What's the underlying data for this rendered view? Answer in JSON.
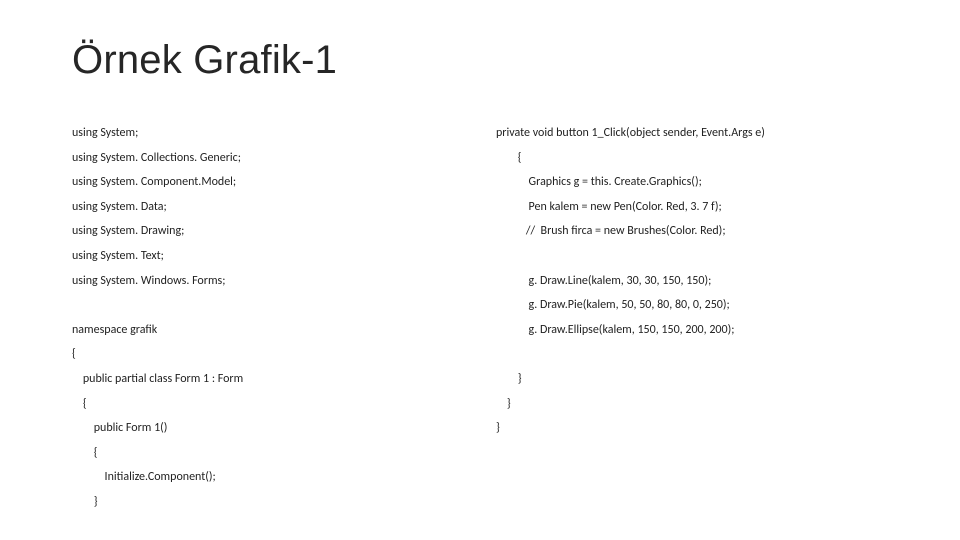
{
  "title": "Örnek Grafik-1",
  "left": [
    "using System;",
    "using System. Collections. Generic;",
    "using System. Component.Model;",
    "using System. Data;",
    "using System. Drawing;",
    "using System. Text;",
    "using System. Windows. Forms;",
    "",
    "namespace grafik",
    "{",
    "    public partial class Form 1 : Form",
    "    {",
    "        public Form 1()",
    "        {",
    "            Initialize.Component();",
    "        }"
  ],
  "right": [
    "private void button 1_Click(object sender, Event.Args e)",
    "        {",
    "            Graphics g = this. Create.Graphics();",
    "            Pen kalem = new Pen(Color. Red, 3. 7 f);",
    "           //  Brush firca = new Brushes(Color. Red);",
    "",
    "            g. Draw.Line(kalem, 30, 30, 150, 150);",
    "            g. Draw.Pie(kalem, 50, 50, 80, 80, 0, 250);",
    "            g. Draw.Ellipse(kalem, 150, 150, 200, 200);",
    "",
    "        }",
    "    }",
    "}"
  ]
}
